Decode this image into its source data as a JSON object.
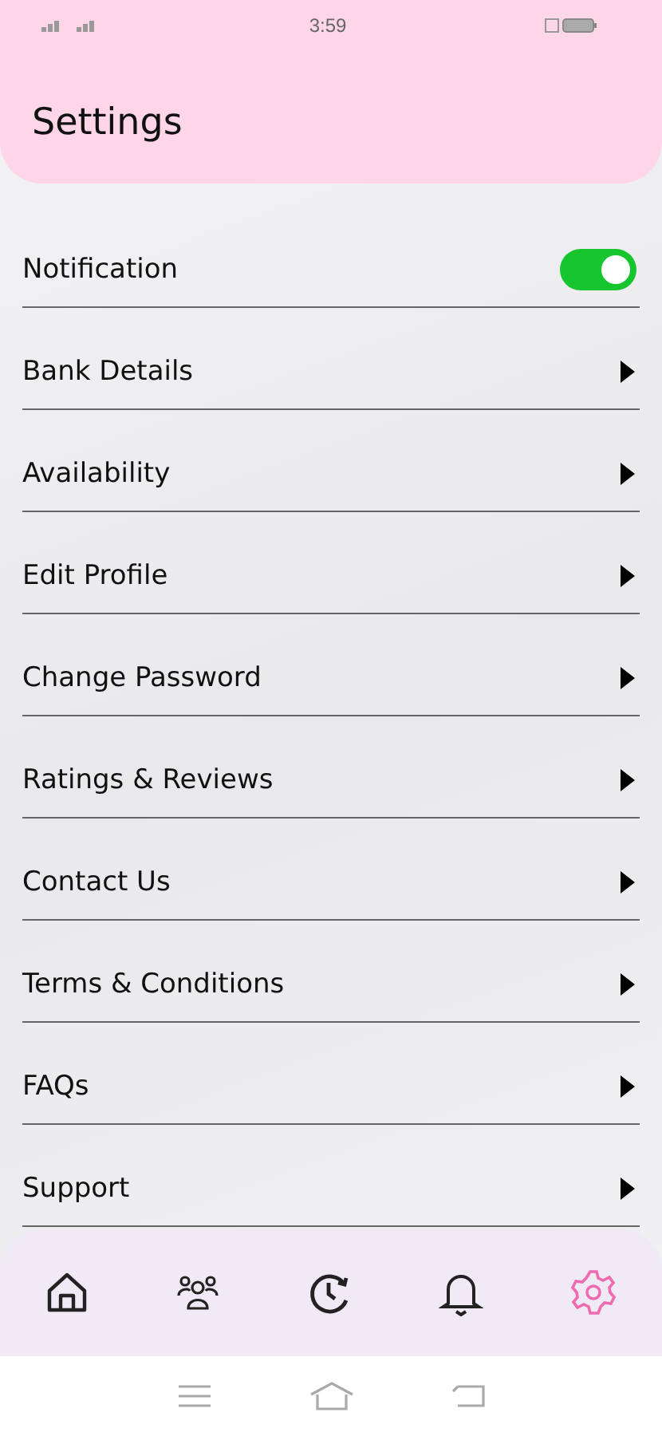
{
  "status_bar": {
    "time": "3:59"
  },
  "header": {
    "title": "Settings"
  },
  "settings": [
    {
      "label": "Notification",
      "kind": "toggle",
      "on": true
    },
    {
      "label": "Bank Details",
      "kind": "link"
    },
    {
      "label": "Availability",
      "kind": "link"
    },
    {
      "label": "Edit Profile",
      "kind": "link"
    },
    {
      "label": "Change Password",
      "kind": "link"
    },
    {
      "label": "Ratings & Reviews",
      "kind": "link"
    },
    {
      "label": "Contact Us",
      "kind": "link"
    },
    {
      "label": "Terms & Conditions",
      "kind": "link"
    },
    {
      "label": "FAQs",
      "kind": "link"
    },
    {
      "label": "Support",
      "kind": "link"
    }
  ],
  "bottom_nav": [
    {
      "kind": "home",
      "selected": false
    },
    {
      "kind": "people",
      "selected": false
    },
    {
      "kind": "history",
      "selected": false
    },
    {
      "kind": "bell",
      "selected": false
    },
    {
      "kind": "gear",
      "selected": true
    }
  ]
}
